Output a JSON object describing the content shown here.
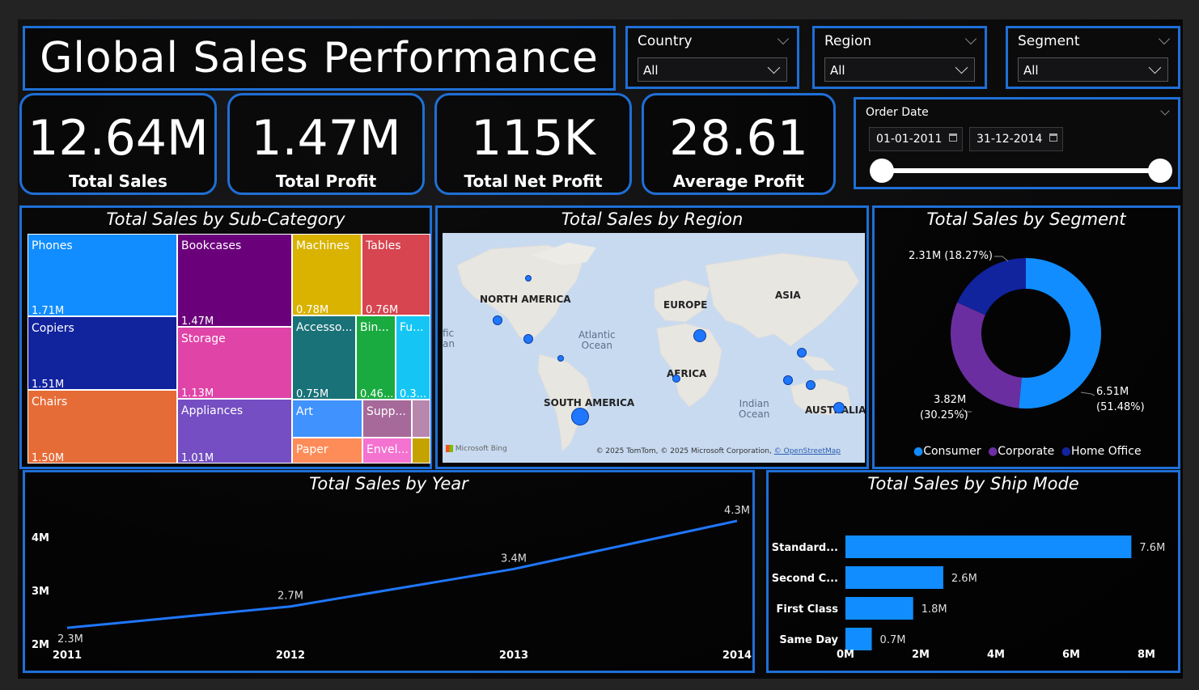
{
  "header": {
    "title": "Global Sales Performance"
  },
  "slicers": [
    {
      "label": "Country",
      "value": "All"
    },
    {
      "label": "Region",
      "value": "All"
    },
    {
      "label": "Segment",
      "value": "All"
    }
  ],
  "date_slicer": {
    "label": "Order Date",
    "start": "01-01-2011",
    "end": "31-12-2014",
    "range_fraction": [
      0,
      1
    ]
  },
  "kpis": [
    {
      "value": "12.64M",
      "caption": "Total Sales"
    },
    {
      "value": "1.47M",
      "caption": "Total Profit"
    },
    {
      "value": "115K",
      "caption": "Total Net Profit"
    },
    {
      "value": "28.61",
      "caption": "Average Profit"
    }
  ],
  "subcategory": {
    "title": "Total Sales by Sub-Category",
    "tiles": [
      {
        "name": "Phones",
        "value": "1.71M",
        "color": "#118dff"
      },
      {
        "name": "Copiers",
        "value": "1.51M",
        "color": "#12239e"
      },
      {
        "name": "Chairs",
        "value": "1.50M",
        "color": "#e66c37"
      },
      {
        "name": "Bookcases",
        "value": "1.47M",
        "color": "#6b007b"
      },
      {
        "name": "Storage",
        "value": "1.13M",
        "color": "#e044a7"
      },
      {
        "name": "Appliances",
        "value": "1.01M",
        "color": "#744ec2"
      },
      {
        "name": "Machines",
        "value": "0.78M",
        "color": "#d9b300"
      },
      {
        "name": "Tables",
        "value": "0.76M",
        "color": "#d64550"
      },
      {
        "name": "Accesso...",
        "value": "0.75M",
        "color": "#197278"
      },
      {
        "name": "Bin...",
        "value": "0.46...",
        "color": "#1aab40"
      },
      {
        "name": "Fu...",
        "value": "0.3...",
        "color": "#15c6f4"
      },
      {
        "name": "Art",
        "value": "",
        "color": "#4092ff"
      },
      {
        "name": "Supp...",
        "value": "",
        "color": "#a66999"
      },
      {
        "name": "",
        "value": "",
        "color": "#b887ad"
      },
      {
        "name": "Paper",
        "value": "",
        "color": "#fd8c59"
      },
      {
        "name": "Envel...",
        "value": "",
        "color": "#f472d0"
      },
      {
        "name": "",
        "value": "",
        "color": "#c4a200"
      }
    ]
  },
  "region_map": {
    "title": "Total Sales by Region",
    "labels": [
      "NORTH AMERICA",
      "EUROPE",
      "ASIA",
      "AFRICA",
      "SOUTH AMERICA",
      "AUSTRALIA"
    ],
    "oceans": [
      "Atlantic Ocean",
      "Indian Ocean",
      "fic an"
    ],
    "bing": "Microsoft Bing",
    "copyright_text": "© 2025 TomTom, © 2025 Microsoft Corporation,",
    "copyright_link": "© OpenStreetMap"
  },
  "segment": {
    "title": "Total Sales by Segment",
    "chart_data": {
      "type": "pie",
      "donut": true,
      "categories": [
        "Consumer",
        "Corporate",
        "Home Office"
      ],
      "values": [
        6.51,
        3.82,
        2.31
      ],
      "percents": [
        51.48,
        30.25,
        18.27
      ],
      "colors": [
        "#118dff",
        "#6b2ea0",
        "#12239e"
      ],
      "legend": "bottom"
    },
    "labels": [
      {
        "l1": "6.51M",
        "l2": "(51.48%)"
      },
      {
        "l1": "3.82M",
        "l2": "(30.25%)"
      },
      {
        "l1": "2.31M (18.27%)",
        "l2": ""
      }
    ],
    "legend": [
      "Consumer",
      "Corporate",
      "Home Office"
    ]
  },
  "year": {
    "title": "Total Sales by Year",
    "chart_data": {
      "type": "line",
      "x": [
        "2011",
        "2012",
        "2013",
        "2014"
      ],
      "values": [
        2.3,
        2.7,
        3.4,
        4.3
      ],
      "data_labels": [
        "2.3M",
        "2.7M",
        "3.4M",
        "4.3M"
      ],
      "yticks": [
        "2M",
        "3M",
        "4M"
      ],
      "ylim": [
        2,
        4.45
      ],
      "color": "#1f77ff"
    }
  },
  "ship": {
    "title": "Total Sales by Ship Mode",
    "chart_data": {
      "type": "bar",
      "orientation": "horizontal",
      "categories": [
        "Standard...",
        "Second C...",
        "First Class",
        "Same Day"
      ],
      "values": [
        7.6,
        2.6,
        1.8,
        0.7
      ],
      "data_labels": [
        "7.6M",
        "2.6M",
        "1.8M",
        "0.7M"
      ],
      "xticks": [
        "0M",
        "2M",
        "4M",
        "6M",
        "8M"
      ],
      "xlim": [
        0,
        8
      ],
      "color": "#118dff"
    }
  }
}
